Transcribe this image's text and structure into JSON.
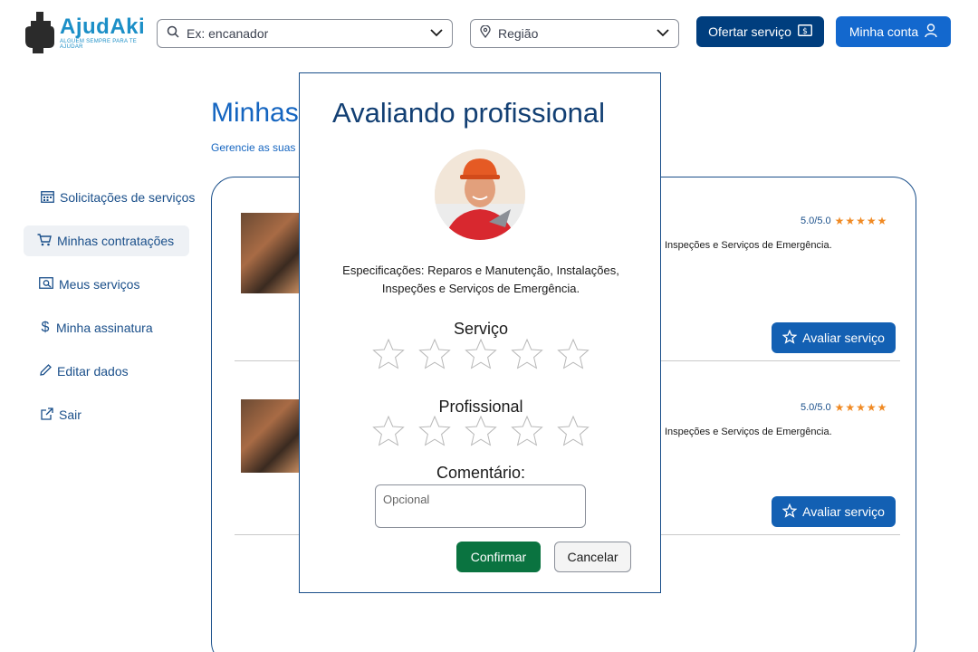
{
  "brand": {
    "name": "AjudAki",
    "tagline": "ALGUEM SEMPRE PARA TE AJUDAR"
  },
  "header": {
    "search_placeholder": "Ex: encanador",
    "region_placeholder": "Região",
    "offer_button": "Ofertar serviço",
    "account_button": "Minha conta"
  },
  "page": {
    "title": "Minhas",
    "subtitle": "Gerencie as suas"
  },
  "sidebar": {
    "items": [
      {
        "label": "Solicitações de serviços",
        "icon": "calendar-icon",
        "active": false
      },
      {
        "label": "Minhas contratações",
        "icon": "cart-icon",
        "active": true
      },
      {
        "label": "Meus serviços",
        "icon": "image-icon",
        "active": false
      },
      {
        "label": "Minha assinatura",
        "icon": "dollar-icon",
        "active": false
      },
      {
        "label": "Editar dados",
        "icon": "pencil-icon",
        "active": false
      },
      {
        "label": "Sair",
        "icon": "external-link-icon",
        "active": false
      }
    ]
  },
  "contracts": [
    {
      "rating": "5.0/5.0",
      "stars": 5,
      "spec": "Inspeções e Serviços de Emergência.",
      "action": "Avaliar serviço"
    },
    {
      "rating": "5.0/5.0",
      "stars": 5,
      "spec": "Inspeções e Serviços de Emergência.",
      "action": "Avaliar serviço"
    }
  ],
  "modal": {
    "title": "Avaliando profissional",
    "spec_line1": "Especificações: Reparos e Manutenção, Instalações,",
    "spec_line2": "Inspeções e Serviços de Emergência.",
    "service_label": "Serviço",
    "service_rating": 0,
    "professional_label": "Profissional",
    "professional_rating": 0,
    "comment_label": "Comentário:",
    "comment_placeholder": "Opcional",
    "confirm": "Confirmar",
    "cancel": "Cancelar"
  },
  "colors": {
    "primary": "#1368ce",
    "dark_blue": "#003e7e",
    "text_blue": "#1a4f8a",
    "confirm_green": "#0a7340",
    "star_orange": "#f08a24"
  }
}
